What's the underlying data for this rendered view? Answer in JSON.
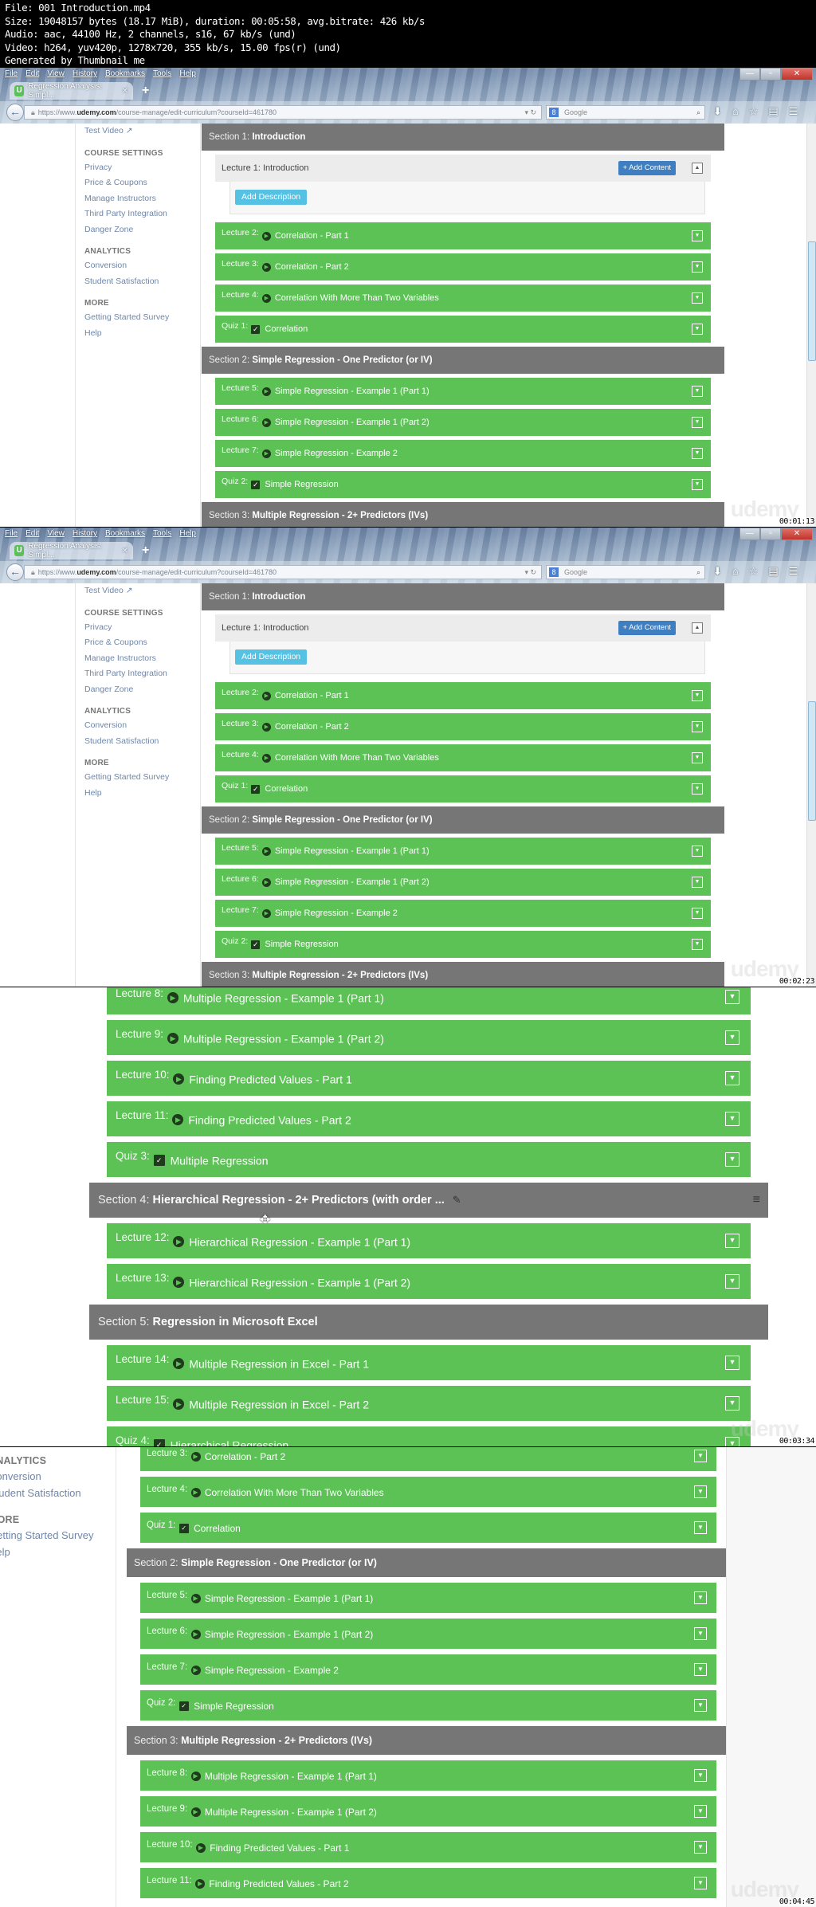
{
  "info": {
    "lines": [
      "File: 001 Introduction.mp4",
      "Size: 19048157 bytes (18.17 MiB), duration: 00:05:58, avg.bitrate: 426 kb/s",
      "Audio: aac, 44100 Hz, 2 channels, s16, 67 kb/s (und)",
      "Video: h264, yuv420p, 1278x720, 355 kb/s, 15.00 fps(r) (und)",
      "Generated by Thumbnail me"
    ]
  },
  "browser": {
    "menu": [
      "File",
      "Edit",
      "View",
      "History",
      "Bookmarks",
      "Tools",
      "Help"
    ],
    "tab_title": "Regression Analysis: Simpl...",
    "tab_favicon": "U",
    "url_prefix": "https://www.",
    "url_domain": "udemy.com",
    "url_path": "/course-manage/edit-curriculum?courseId=461780",
    "search_placeholder": "Google",
    "window_controls": {
      "minimize": "—",
      "restore": "▫",
      "close": "✕"
    }
  },
  "sidebar": {
    "top_link": "Test Video ↗",
    "groups": [
      {
        "heading": "COURSE SETTINGS",
        "links": [
          "Privacy",
          "Price & Coupons",
          "Manage Instructors",
          "Third Party Integration",
          "Danger Zone"
        ]
      },
      {
        "heading": "ANALYTICS",
        "links": [
          "Conversion",
          "Student Satisfaction"
        ]
      },
      {
        "heading": "MORE",
        "links": [
          "Getting Started Survey",
          "Help"
        ]
      }
    ]
  },
  "curriculum": {
    "add_content_label": "+ Add Content",
    "add_description_label": "Add Description",
    "section_label_prefix": "Section",
    "sections": [
      {
        "label": "Section 1:",
        "title": "Introduction"
      },
      {
        "label": "Section 2:",
        "title": "Simple Regression - One Predictor (or IV)"
      },
      {
        "label": "Section 3:",
        "title": "Multiple Regression - 2+ Predictors (IVs)"
      },
      {
        "label": "Section 4:",
        "title": "Hierarchical Regression - 2+ Predictors (with order ..."
      },
      {
        "label": "Section 5:",
        "title": "Regression in Microsoft Excel"
      }
    ],
    "items": [
      {
        "label": "Lecture 1:",
        "title": "Introduction",
        "kind": "lecture"
      },
      {
        "label": "Lecture 2:",
        "title": "Correlation - Part 1",
        "kind": "video"
      },
      {
        "label": "Lecture 3:",
        "title": "Correlation - Part 2",
        "kind": "video"
      },
      {
        "label": "Lecture 4:",
        "title": "Correlation With More Than Two Variables",
        "kind": "video"
      },
      {
        "label": "Quiz 1:",
        "title": "Correlation",
        "kind": "quiz"
      },
      {
        "label": "Lecture 5:",
        "title": "Simple Regression - Example 1 (Part 1)",
        "kind": "video"
      },
      {
        "label": "Lecture 6:",
        "title": "Simple Regression - Example 1 (Part 2)",
        "kind": "video"
      },
      {
        "label": "Lecture 7:",
        "title": "Simple Regression - Example 2",
        "kind": "video"
      },
      {
        "label": "Quiz 2:",
        "title": "Simple Regression",
        "kind": "quiz"
      },
      {
        "label": "Lecture 8:",
        "title": "Multiple Regression - Example 1 (Part 1)",
        "kind": "video"
      },
      {
        "label": "Lecture 9:",
        "title": "Multiple Regression - Example 1 (Part 2)",
        "kind": "video"
      },
      {
        "label": "Lecture 10:",
        "title": "Finding Predicted Values - Part 1",
        "kind": "video"
      },
      {
        "label": "Lecture 11:",
        "title": "Finding Predicted Values - Part 2",
        "kind": "video"
      },
      {
        "label": "Quiz 3:",
        "title": "Multiple Regression",
        "kind": "quiz"
      },
      {
        "label": "Lecture 12:",
        "title": "Hierarchical Regression - Example 1 (Part 1)",
        "kind": "video"
      },
      {
        "label": "Lecture 13:",
        "title": "Hierarchical Regression - Example 1 (Part 2)",
        "kind": "video"
      },
      {
        "label": "Lecture 14:",
        "title": "Multiple Regression in Excel - Part 1",
        "kind": "video"
      },
      {
        "label": "Lecture 15:",
        "title": "Multiple Regression in Excel - Part 2",
        "kind": "video"
      },
      {
        "label": "Quiz 4:",
        "title": "Hierarchical Regression",
        "kind": "quiz"
      }
    ]
  },
  "frames": [
    {
      "timestamp": "00:01:13"
    },
    {
      "timestamp": "00:02:23"
    },
    {
      "timestamp": "00:03:34"
    },
    {
      "timestamp": "00:04:45"
    }
  ],
  "watermark": "udemy",
  "colors": {
    "green": "#5cc256",
    "section_gray": "#767676",
    "link_blue": "#6f86a8",
    "add_content_blue": "#3f7fc1",
    "add_description_cyan": "#55c1e3"
  }
}
